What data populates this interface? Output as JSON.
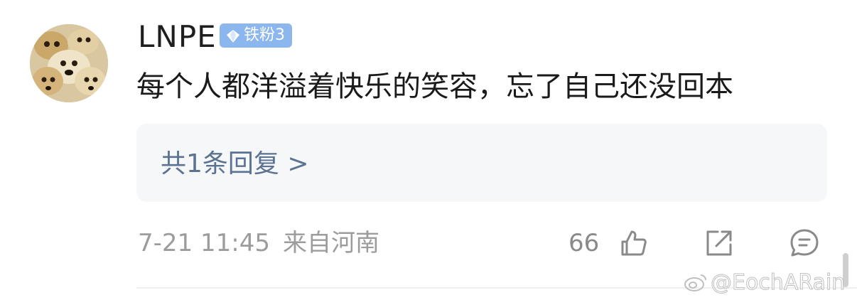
{
  "user": {
    "name": "LNPE",
    "badge": "铁粉3"
  },
  "comment": {
    "text": "每个人都洋溢着快乐的笑容，忘了自己还没回本"
  },
  "replies": {
    "label": "共1条回复 >"
  },
  "meta": {
    "time": "7-21 11:45",
    "location": "来自河南",
    "likes": "66"
  },
  "icons": {
    "like": "thumbs-up-icon",
    "share": "share-icon",
    "reply": "comment-icon"
  },
  "watermark": {
    "text": "@EochARain"
  },
  "colors": {
    "badge_bg": "#8cb6ee",
    "reply_text": "#5b7291",
    "meta_text": "#9c9c9c"
  }
}
